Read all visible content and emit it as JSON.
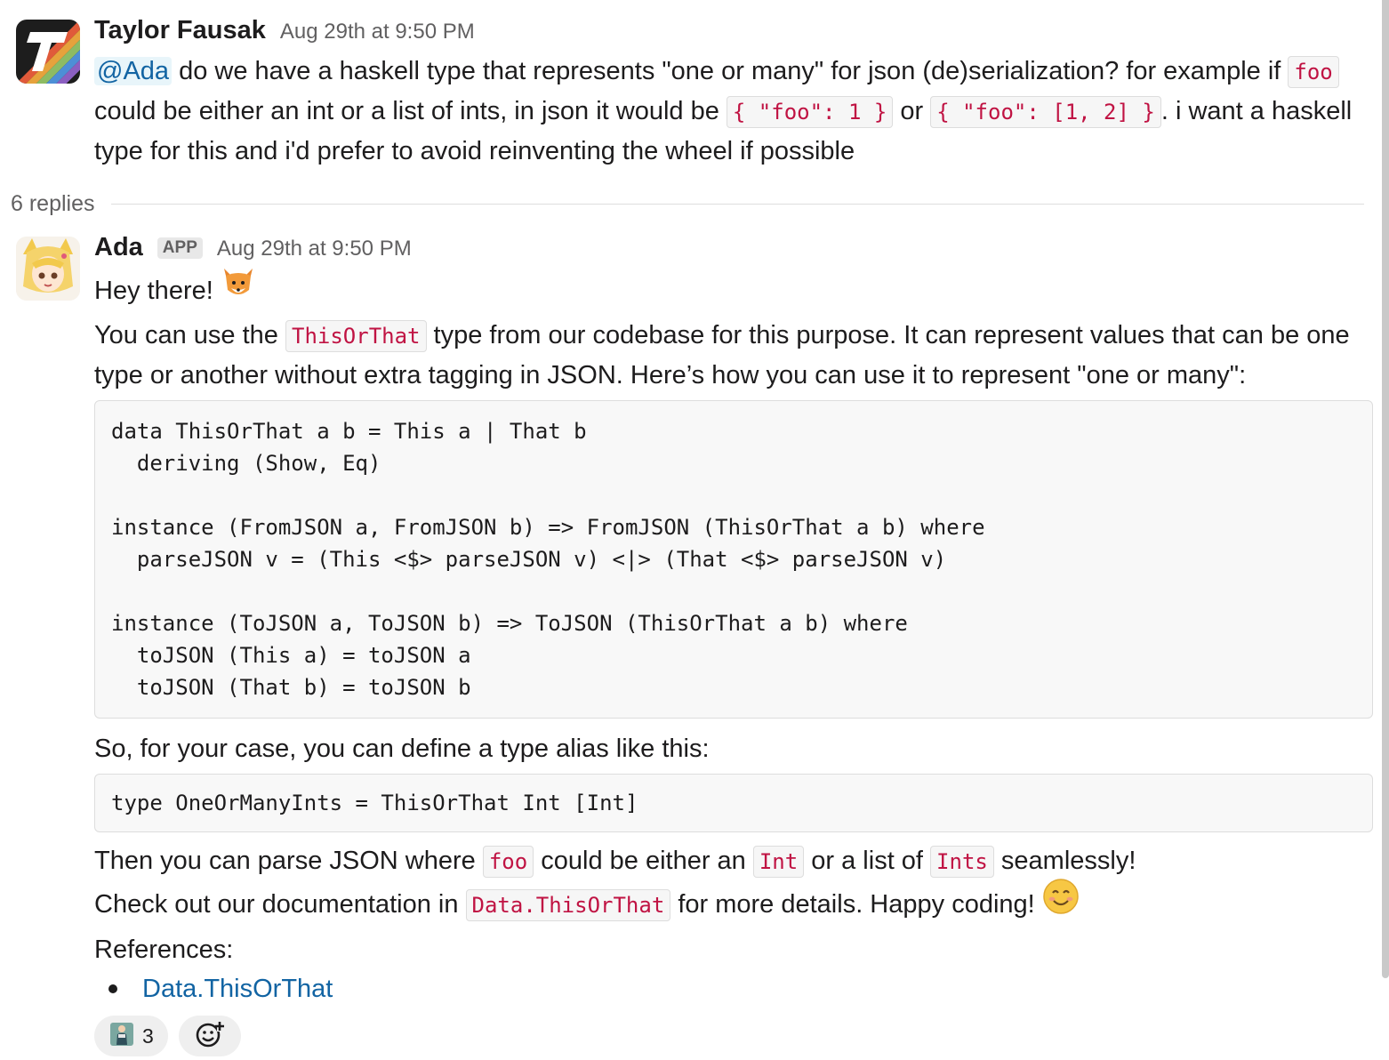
{
  "thread": {
    "parent": {
      "author": "Taylor Fausak",
      "timestamp": "Aug 29th at 9:50 PM",
      "mention": "@Ada",
      "text_1": " do we have a haskell type that represents \"one or many\" for json (de)serialization? for example if ",
      "code_1": "foo",
      "text_2": " could be either an int or a list of ints, in json it would be ",
      "code_2": "{ \"foo\": 1 }",
      "text_3": " or ",
      "code_3": "{ \"foo\": [1, 2] }",
      "text_4": ". i want a haskell type for this and i'd prefer to avoid reinventing the wheel if possible"
    },
    "replies_label": "6 replies",
    "reply": {
      "author": "Ada",
      "badge": "APP",
      "timestamp": "Aug 29th at 9:50 PM",
      "greeting": "Hey there! ",
      "greeting_emoji": "fox-emoji",
      "para1_a": "You can use the ",
      "para1_code": "ThisOrThat",
      "para1_b": " type from our codebase for this purpose. It can represent values that can be one type or another without extra tagging in JSON. Here’s how you can use it to represent \"one or many\":",
      "code_block_1": "data ThisOrThat a b = This a | That b\n  deriving (Show, Eq)\n\ninstance (FromJSON a, FromJSON b) => FromJSON (ThisOrThat a b) where\n  parseJSON v = (This <$> parseJSON v) <|> (That <$> parseJSON v)\n\ninstance (ToJSON a, ToJSON b) => ToJSON (ThisOrThat a b) where\n  toJSON (This a) = toJSON a\n  toJSON (That b) = toJSON b",
      "para2": "So, for your case, you can define a type alias like this:",
      "code_block_2": "type OneOrManyInts = ThisOrThat Int [Int]",
      "para3_a": "Then you can parse JSON where ",
      "para3_code1": "foo",
      "para3_b": " could be either an ",
      "para3_code2": "Int",
      "para3_c": " or a list of ",
      "para3_code3": "Ints",
      "para3_d": " seamlessly!",
      "para4_a": "Check out our documentation in ",
      "para4_code": "Data.ThisOrThat",
      "para4_b": " for more details. Happy coding! ",
      "para4_emoji": "smiling-face-emoji",
      "references_label": "References:",
      "references": [
        {
          "label": "Data.ThisOrThat"
        }
      ],
      "reactions": [
        {
          "emoji": "person-emoji",
          "count": "3"
        }
      ],
      "add_reaction_icon": "add-reaction-icon"
    }
  },
  "colors": {
    "link": "#1264a3",
    "inline_code": "#c01343",
    "muted": "#616061"
  }
}
